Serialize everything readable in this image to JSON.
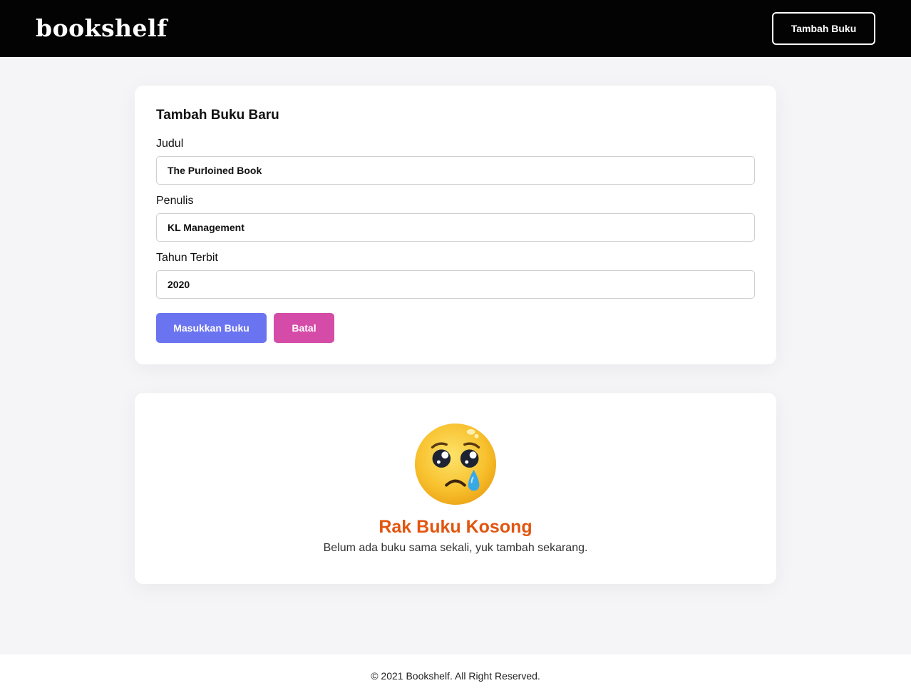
{
  "header": {
    "brand": "bookshelf",
    "add_button": "Tambah Buku"
  },
  "form": {
    "title": "Tambah Buku Baru",
    "fields": [
      {
        "label": "Judul",
        "value": "The Purloined Book"
      },
      {
        "label": "Penulis",
        "value": "KL Management"
      },
      {
        "label": "Tahun Terbit",
        "value": "2020"
      }
    ],
    "submit_label": "Masukkan Buku",
    "cancel_label": "Batal"
  },
  "empty_state": {
    "icon": "crying-face-icon",
    "title": "Rak Buku Kosong",
    "subtitle": "Belum ada buku sama sekali, yuk tambah sekarang."
  },
  "footer": {
    "text": "© 2021 Bookshelf. All Right Reserved."
  },
  "colors": {
    "header_bg": "#030303",
    "primary": "#6b74f0",
    "cancel": "#d54ba8",
    "empty_title": "#e2550f"
  }
}
